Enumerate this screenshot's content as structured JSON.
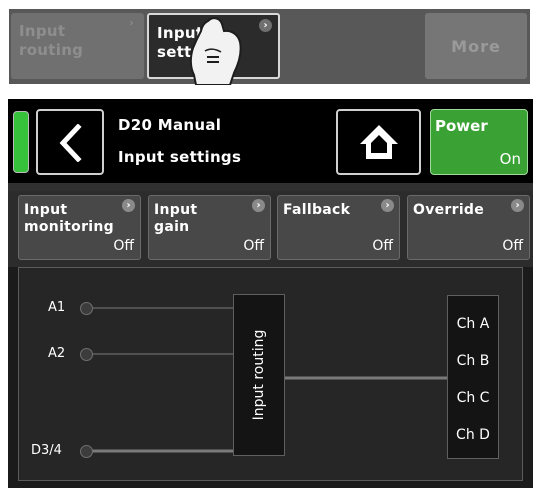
{
  "top_strip": {
    "input_routing": {
      "label_line1": "Input",
      "label_line2": "routing",
      "chevron": "›"
    },
    "input_settings": {
      "label_line1": "Input",
      "label_line2": "sett",
      "chevron": "›"
    },
    "more": {
      "label": "More"
    },
    "hand_icon": "pointing-hand-icon"
  },
  "header": {
    "title": "D20 Manual",
    "subtitle": "Input settings",
    "back_icon": "chevron-left-icon",
    "home_icon": "home-icon",
    "power": {
      "label": "Power",
      "value": "On"
    },
    "status_led_color": "#36c23a"
  },
  "functions": [
    {
      "line1": "Input",
      "line2": "monitoring",
      "value": "Off",
      "chevron": "›"
    },
    {
      "line1": "Input",
      "line2": "gain",
      "value": "Off",
      "chevron": "›"
    },
    {
      "line1": "Fallback",
      "line2": "",
      "value": "Off",
      "chevron": "›"
    },
    {
      "line1": "Override",
      "line2": "",
      "value": "Off",
      "chevron": "›"
    }
  ],
  "diagram": {
    "inputs": [
      "A1",
      "A2",
      "D3/4"
    ],
    "routing_label": "Input routing",
    "channels": [
      "Ch A",
      "Ch B",
      "Ch C",
      "Ch D"
    ]
  },
  "colors": {
    "power_green": "#3aa234",
    "screen_bg": "#1b1b1b"
  }
}
